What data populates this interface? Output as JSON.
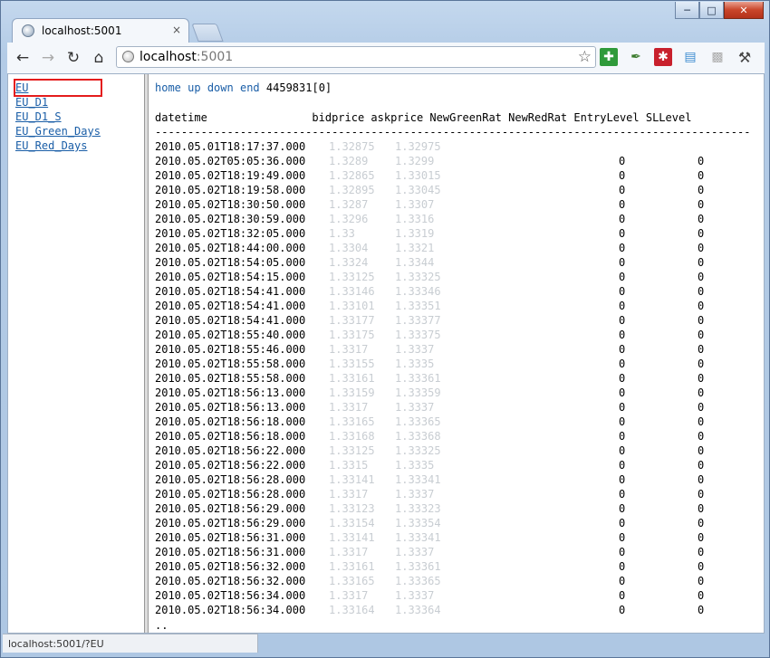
{
  "window": {
    "min_icon": "minimize-icon",
    "max_icon": "maximize-icon",
    "close_icon": "close-icon"
  },
  "tab": {
    "title": "localhost:5001",
    "close": "×"
  },
  "omnibox": {
    "host": "localhost",
    "port": ":5001"
  },
  "sidebar": {
    "items": [
      {
        "label": "EU"
      },
      {
        "label": "EU_D1"
      },
      {
        "label": "EU_D1_S"
      },
      {
        "label": "EU_Green_Days"
      },
      {
        "label": "EU_Red_Days"
      }
    ]
  },
  "main": {
    "links": {
      "home": "home",
      "up": "up",
      "down": "down",
      "end": "end"
    },
    "position": "4459831[0]",
    "header": "datetime                bidprice askprice NewGreenRat NewRedRat EntryLevel SLLevel",
    "rule": "-------------------------------------------------------------------------------------------",
    "rows": [
      {
        "dt": "2010.05.01T18:17:37.000",
        "bid": "1.32875",
        "ask": "1.32975",
        "entry": "",
        "sl": ""
      },
      {
        "dt": "2010.05.02T05:05:36.000",
        "bid": "1.3289",
        "ask": "1.3299",
        "entry": "0",
        "sl": "0"
      },
      {
        "dt": "2010.05.02T18:19:49.000",
        "bid": "1.32865",
        "ask": "1.33015",
        "entry": "0",
        "sl": "0"
      },
      {
        "dt": "2010.05.02T18:19:58.000",
        "bid": "1.32895",
        "ask": "1.33045",
        "entry": "0",
        "sl": "0"
      },
      {
        "dt": "2010.05.02T18:30:50.000",
        "bid": "1.3287",
        "ask": "1.3307",
        "entry": "0",
        "sl": "0"
      },
      {
        "dt": "2010.05.02T18:30:59.000",
        "bid": "1.3296",
        "ask": "1.3316",
        "entry": "0",
        "sl": "0"
      },
      {
        "dt": "2010.05.02T18:32:05.000",
        "bid": "1.33",
        "ask": "1.3319",
        "entry": "0",
        "sl": "0"
      },
      {
        "dt": "2010.05.02T18:44:00.000",
        "bid": "1.3304",
        "ask": "1.3321",
        "entry": "0",
        "sl": "0"
      },
      {
        "dt": "2010.05.02T18:54:05.000",
        "bid": "1.3324",
        "ask": "1.3344",
        "entry": "0",
        "sl": "0"
      },
      {
        "dt": "2010.05.02T18:54:15.000",
        "bid": "1.33125",
        "ask": "1.33325",
        "entry": "0",
        "sl": "0"
      },
      {
        "dt": "2010.05.02T18:54:41.000",
        "bid": "1.33146",
        "ask": "1.33346",
        "entry": "0",
        "sl": "0"
      },
      {
        "dt": "2010.05.02T18:54:41.000",
        "bid": "1.33101",
        "ask": "1.33351",
        "entry": "0",
        "sl": "0"
      },
      {
        "dt": "2010.05.02T18:54:41.000",
        "bid": "1.33177",
        "ask": "1.33377",
        "entry": "0",
        "sl": "0"
      },
      {
        "dt": "2010.05.02T18:55:40.000",
        "bid": "1.33175",
        "ask": "1.33375",
        "entry": "0",
        "sl": "0"
      },
      {
        "dt": "2010.05.02T18:55:46.000",
        "bid": "1.3317",
        "ask": "1.3337",
        "entry": "0",
        "sl": "0"
      },
      {
        "dt": "2010.05.02T18:55:58.000",
        "bid": "1.33155",
        "ask": "1.3335",
        "entry": "0",
        "sl": "0"
      },
      {
        "dt": "2010.05.02T18:55:58.000",
        "bid": "1.33161",
        "ask": "1.33361",
        "entry": "0",
        "sl": "0"
      },
      {
        "dt": "2010.05.02T18:56:13.000",
        "bid": "1.33159",
        "ask": "1.33359",
        "entry": "0",
        "sl": "0"
      },
      {
        "dt": "2010.05.02T18:56:13.000",
        "bid": "1.3317",
        "ask": "1.3337",
        "entry": "0",
        "sl": "0"
      },
      {
        "dt": "2010.05.02T18:56:18.000",
        "bid": "1.33165",
        "ask": "1.33365",
        "entry": "0",
        "sl": "0"
      },
      {
        "dt": "2010.05.02T18:56:18.000",
        "bid": "1.33168",
        "ask": "1.33368",
        "entry": "0",
        "sl": "0"
      },
      {
        "dt": "2010.05.02T18:56:22.000",
        "bid": "1.33125",
        "ask": "1.33325",
        "entry": "0",
        "sl": "0"
      },
      {
        "dt": "2010.05.02T18:56:22.000",
        "bid": "1.3315",
        "ask": "1.3335",
        "entry": "0",
        "sl": "0"
      },
      {
        "dt": "2010.05.02T18:56:28.000",
        "bid": "1.33141",
        "ask": "1.33341",
        "entry": "0",
        "sl": "0"
      },
      {
        "dt": "2010.05.02T18:56:28.000",
        "bid": "1.3317",
        "ask": "1.3337",
        "entry": "0",
        "sl": "0"
      },
      {
        "dt": "2010.05.02T18:56:29.000",
        "bid": "1.33123",
        "ask": "1.33323",
        "entry": "0",
        "sl": "0"
      },
      {
        "dt": "2010.05.02T18:56:29.000",
        "bid": "1.33154",
        "ask": "1.33354",
        "entry": "0",
        "sl": "0"
      },
      {
        "dt": "2010.05.02T18:56:31.000",
        "bid": "1.33141",
        "ask": "1.33341",
        "entry": "0",
        "sl": "0"
      },
      {
        "dt": "2010.05.02T18:56:31.000",
        "bid": "1.3317",
        "ask": "1.3337",
        "entry": "0",
        "sl": "0"
      },
      {
        "dt": "2010.05.02T18:56:32.000",
        "bid": "1.33161",
        "ask": "1.33361",
        "entry": "0",
        "sl": "0"
      },
      {
        "dt": "2010.05.02T18:56:32.000",
        "bid": "1.33165",
        "ask": "1.33365",
        "entry": "0",
        "sl": "0"
      },
      {
        "dt": "2010.05.02T18:56:34.000",
        "bid": "1.3317",
        "ask": "1.3337",
        "entry": "0",
        "sl": "0"
      },
      {
        "dt": "2010.05.02T18:56:34.000",
        "bid": "1.33164",
        "ask": "1.33364",
        "entry": "0",
        "sl": "0"
      }
    ],
    "more": ".."
  },
  "status": {
    "url": "localhost:5001/?EU"
  },
  "colors": {
    "link": "#1a5ea7",
    "highlight": "#e41c1c",
    "faded": "#c8cdd2"
  }
}
